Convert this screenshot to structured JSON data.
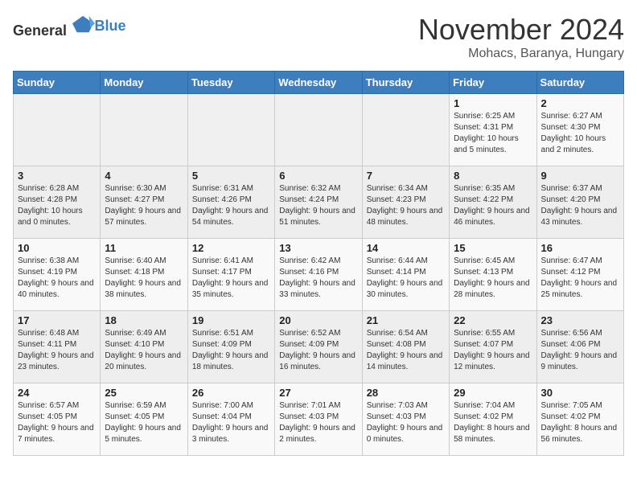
{
  "header": {
    "logo_general": "General",
    "logo_blue": "Blue",
    "title": "November 2024",
    "subtitle": "Mohacs, Baranya, Hungary"
  },
  "days_of_week": [
    "Sunday",
    "Monday",
    "Tuesday",
    "Wednesday",
    "Thursday",
    "Friday",
    "Saturday"
  ],
  "weeks": [
    [
      {
        "day": "",
        "info": ""
      },
      {
        "day": "",
        "info": ""
      },
      {
        "day": "",
        "info": ""
      },
      {
        "day": "",
        "info": ""
      },
      {
        "day": "",
        "info": ""
      },
      {
        "day": "1",
        "info": "Sunrise: 6:25 AM\nSunset: 4:31 PM\nDaylight: 10 hours and 5 minutes."
      },
      {
        "day": "2",
        "info": "Sunrise: 6:27 AM\nSunset: 4:30 PM\nDaylight: 10 hours and 2 minutes."
      }
    ],
    [
      {
        "day": "3",
        "info": "Sunrise: 6:28 AM\nSunset: 4:28 PM\nDaylight: 10 hours and 0 minutes."
      },
      {
        "day": "4",
        "info": "Sunrise: 6:30 AM\nSunset: 4:27 PM\nDaylight: 9 hours and 57 minutes."
      },
      {
        "day": "5",
        "info": "Sunrise: 6:31 AM\nSunset: 4:26 PM\nDaylight: 9 hours and 54 minutes."
      },
      {
        "day": "6",
        "info": "Sunrise: 6:32 AM\nSunset: 4:24 PM\nDaylight: 9 hours and 51 minutes."
      },
      {
        "day": "7",
        "info": "Sunrise: 6:34 AM\nSunset: 4:23 PM\nDaylight: 9 hours and 48 minutes."
      },
      {
        "day": "8",
        "info": "Sunrise: 6:35 AM\nSunset: 4:22 PM\nDaylight: 9 hours and 46 minutes."
      },
      {
        "day": "9",
        "info": "Sunrise: 6:37 AM\nSunset: 4:20 PM\nDaylight: 9 hours and 43 minutes."
      }
    ],
    [
      {
        "day": "10",
        "info": "Sunrise: 6:38 AM\nSunset: 4:19 PM\nDaylight: 9 hours and 40 minutes."
      },
      {
        "day": "11",
        "info": "Sunrise: 6:40 AM\nSunset: 4:18 PM\nDaylight: 9 hours and 38 minutes."
      },
      {
        "day": "12",
        "info": "Sunrise: 6:41 AM\nSunset: 4:17 PM\nDaylight: 9 hours and 35 minutes."
      },
      {
        "day": "13",
        "info": "Sunrise: 6:42 AM\nSunset: 4:16 PM\nDaylight: 9 hours and 33 minutes."
      },
      {
        "day": "14",
        "info": "Sunrise: 6:44 AM\nSunset: 4:14 PM\nDaylight: 9 hours and 30 minutes."
      },
      {
        "day": "15",
        "info": "Sunrise: 6:45 AM\nSunset: 4:13 PM\nDaylight: 9 hours and 28 minutes."
      },
      {
        "day": "16",
        "info": "Sunrise: 6:47 AM\nSunset: 4:12 PM\nDaylight: 9 hours and 25 minutes."
      }
    ],
    [
      {
        "day": "17",
        "info": "Sunrise: 6:48 AM\nSunset: 4:11 PM\nDaylight: 9 hours and 23 minutes."
      },
      {
        "day": "18",
        "info": "Sunrise: 6:49 AM\nSunset: 4:10 PM\nDaylight: 9 hours and 20 minutes."
      },
      {
        "day": "19",
        "info": "Sunrise: 6:51 AM\nSunset: 4:09 PM\nDaylight: 9 hours and 18 minutes."
      },
      {
        "day": "20",
        "info": "Sunrise: 6:52 AM\nSunset: 4:09 PM\nDaylight: 9 hours and 16 minutes."
      },
      {
        "day": "21",
        "info": "Sunrise: 6:54 AM\nSunset: 4:08 PM\nDaylight: 9 hours and 14 minutes."
      },
      {
        "day": "22",
        "info": "Sunrise: 6:55 AM\nSunset: 4:07 PM\nDaylight: 9 hours and 12 minutes."
      },
      {
        "day": "23",
        "info": "Sunrise: 6:56 AM\nSunset: 4:06 PM\nDaylight: 9 hours and 9 minutes."
      }
    ],
    [
      {
        "day": "24",
        "info": "Sunrise: 6:57 AM\nSunset: 4:05 PM\nDaylight: 9 hours and 7 minutes."
      },
      {
        "day": "25",
        "info": "Sunrise: 6:59 AM\nSunset: 4:05 PM\nDaylight: 9 hours and 5 minutes."
      },
      {
        "day": "26",
        "info": "Sunrise: 7:00 AM\nSunset: 4:04 PM\nDaylight: 9 hours and 3 minutes."
      },
      {
        "day": "27",
        "info": "Sunrise: 7:01 AM\nSunset: 4:03 PM\nDaylight: 9 hours and 2 minutes."
      },
      {
        "day": "28",
        "info": "Sunrise: 7:03 AM\nSunset: 4:03 PM\nDaylight: 9 hours and 0 minutes."
      },
      {
        "day": "29",
        "info": "Sunrise: 7:04 AM\nSunset: 4:02 PM\nDaylight: 8 hours and 58 minutes."
      },
      {
        "day": "30",
        "info": "Sunrise: 7:05 AM\nSunset: 4:02 PM\nDaylight: 8 hours and 56 minutes."
      }
    ]
  ]
}
